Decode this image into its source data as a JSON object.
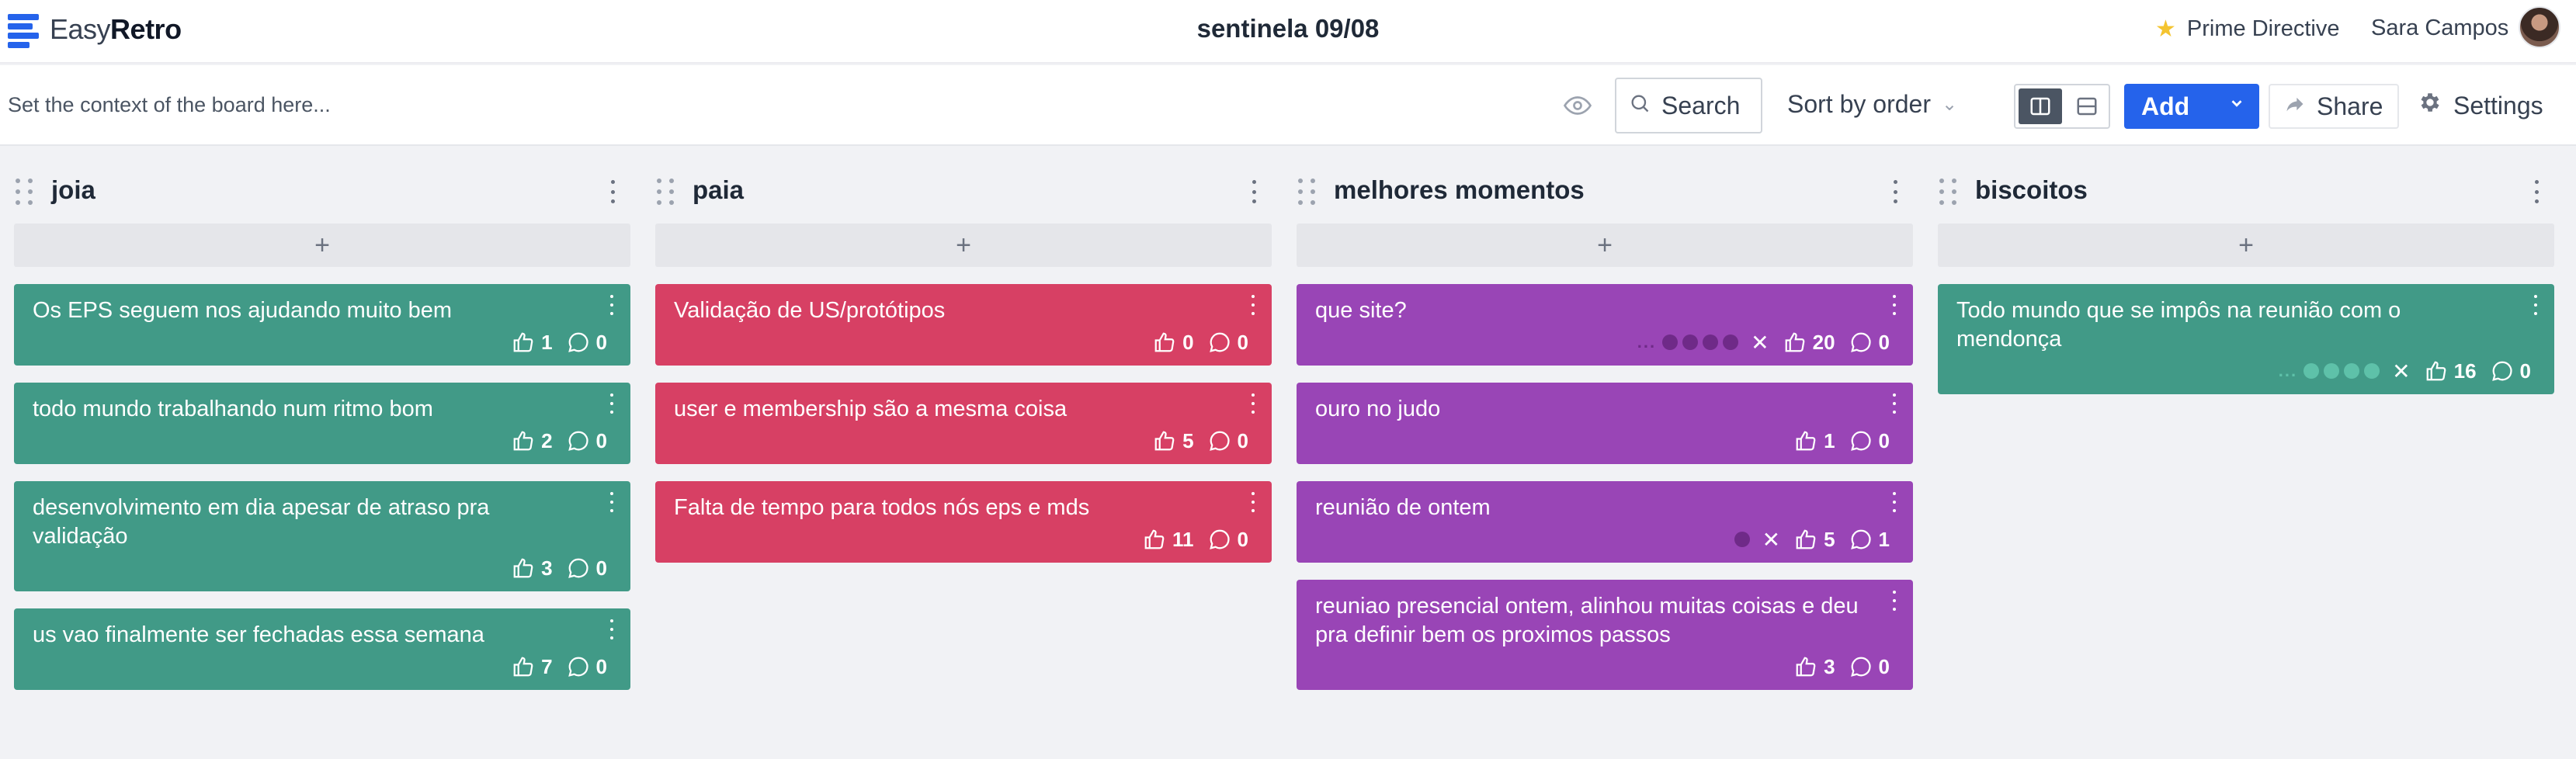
{
  "header": {
    "logo_easy": "Easy",
    "logo_retro": "Retro",
    "board_title": "sentinela 09/08",
    "prime_directive": "Prime Directive",
    "user_name": "Sara Campos"
  },
  "toolbar": {
    "context_placeholder": "Set the context of the board here...",
    "search_label": "Search",
    "sort_label": "Sort by order",
    "add_label": "Add",
    "share_label": "Share",
    "settings_label": "Settings"
  },
  "colors": {
    "green": "#419a87",
    "red": "#d74064",
    "purple": "#9945b6",
    "accent": "#2563eb"
  },
  "columns": [
    {
      "title": "joia",
      "color": "green",
      "add_symbol": "+",
      "cards": [
        {
          "text": "Os EPS seguem nos ajudando muito bem",
          "likes": "1",
          "comments": "0"
        },
        {
          "text": "todo mundo trabalhando num ritmo bom",
          "likes": "2",
          "comments": "0"
        },
        {
          "text": "desenvolvimento em dia apesar de atraso pra validação",
          "likes": "3",
          "comments": "0"
        },
        {
          "text": "us vao finalmente ser fechadas essa semana",
          "likes": "7",
          "comments": "0"
        }
      ]
    },
    {
      "title": "paia",
      "color": "red",
      "add_symbol": "+",
      "cards": [
        {
          "text": "Validação de US/protótipos",
          "likes": "0",
          "comments": "0"
        },
        {
          "text": "user e membership são a mesma coisa",
          "likes": "5",
          "comments": "0"
        },
        {
          "text": "Falta de tempo para todos nós eps e mds",
          "likes": "11",
          "comments": "0"
        }
      ]
    },
    {
      "title": "melhores momentos",
      "color": "purple",
      "add_symbol": "+",
      "cards": [
        {
          "text": "que site?",
          "likes": "20",
          "comments": "0",
          "voters_dots": 4,
          "show_ellipsis": true
        },
        {
          "text": "ouro no judo",
          "likes": "1",
          "comments": "0"
        },
        {
          "text": "reunião de ontem",
          "likes": "5",
          "comments": "1",
          "voters_dots": 1,
          "show_ellipsis": false
        },
        {
          "text": "reuniao presencial ontem, alinhou muitas coisas e deu pra definir bem os proximos passos",
          "likes": "3",
          "comments": "0"
        }
      ]
    },
    {
      "title": "biscoitos",
      "color": "green",
      "add_symbol": "+",
      "cards": [
        {
          "text": "Todo mundo que se impôs na reunião com o mendonça",
          "likes": "16",
          "comments": "0",
          "voters_dots": 4,
          "show_ellipsis": true
        }
      ]
    }
  ]
}
